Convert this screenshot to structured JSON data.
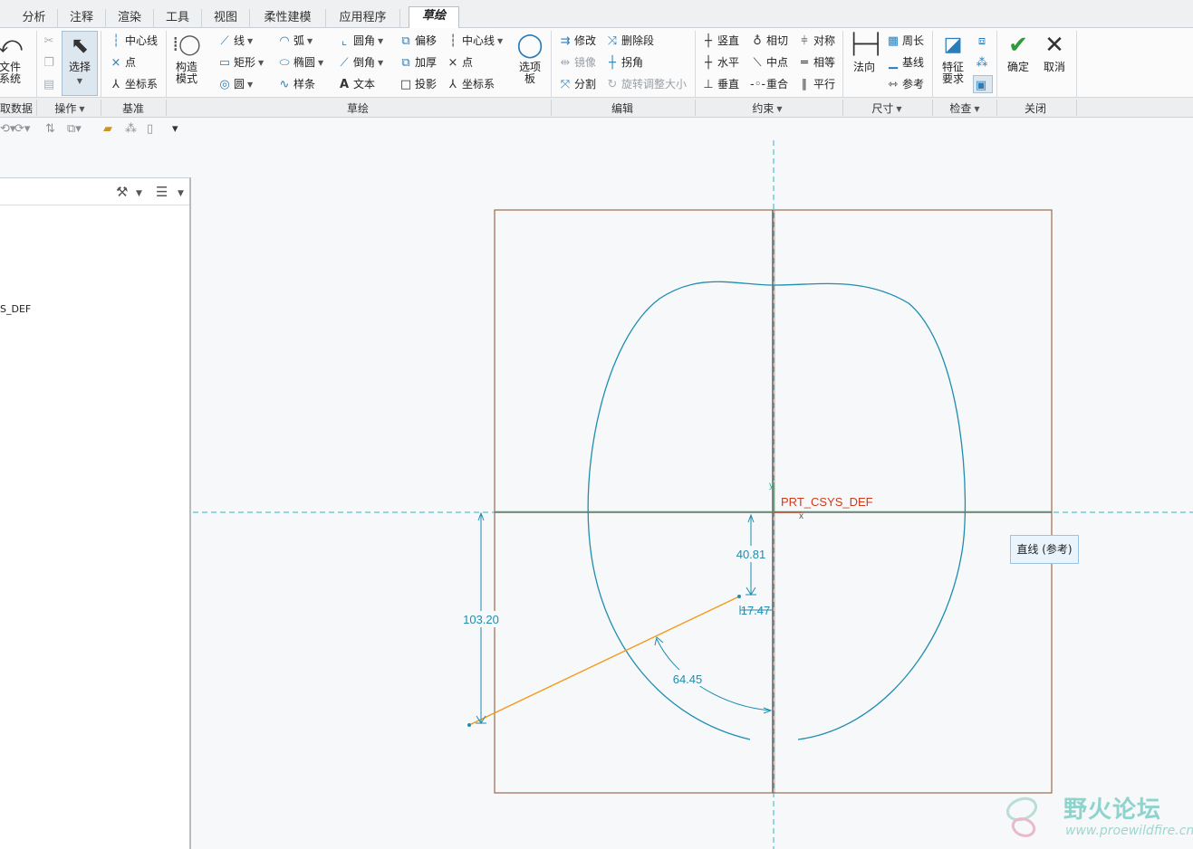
{
  "tabs": [
    "分析",
    "注释",
    "渲染",
    "工具",
    "视图",
    "柔性建模",
    "应用程序",
    "草绘"
  ],
  "ribbon": {
    "get_data": {
      "label1": "文件",
      "label2": "系统"
    },
    "operations": {
      "select_label": "选择"
    },
    "datum": {
      "centerline": "中心线",
      "point": "点",
      "csys": "坐标系"
    },
    "construction": {
      "label1": "构造",
      "label2": "模式"
    },
    "sketch": {
      "line": "线",
      "arc": "弧",
      "fillet": "圆角",
      "offset": "偏移",
      "centerline": "中心线",
      "rectangle": "矩形",
      "ellipse": "椭圆",
      "chamfer": "倒角",
      "thicken": "加厚",
      "point": "点",
      "circle": "圆",
      "spline": "样条",
      "text": "文本",
      "project": "投影",
      "csys": "坐标系",
      "palette1": "选项",
      "palette2": "板"
    },
    "edit": {
      "modify": "修改",
      "delete_segment": "删除段",
      "mirror": "镜像",
      "corner": "拐角",
      "divide": "分割",
      "rotate_resize": "旋转调整大小"
    },
    "constrain": {
      "vertical": "竖直",
      "tangent": "相切",
      "symmetric": "对称",
      "horizontal": "水平",
      "midpoint": "中点",
      "equal": "相等",
      "perpendicular": "垂直",
      "coincident": "重合",
      "parallel": "平行"
    },
    "dimension": {
      "normal": "法向",
      "perimeter": "周长",
      "baseline": "基线",
      "reference": "参考"
    },
    "inspect": {
      "feature_req1": "特征",
      "feature_req2": "要求"
    },
    "close": {
      "ok": "确定",
      "cancel": "取消"
    }
  },
  "groups": [
    "取数据",
    "操作",
    "基准",
    "草绘",
    "编辑",
    "约束",
    "尺寸",
    "检查",
    "关闭"
  ],
  "tree": {
    "item": "S_DEF"
  },
  "canvas": {
    "csys_label": "PRT_CSYS_DEF",
    "axis_y_label": "y",
    "axis_x_label": "x",
    "dims": [
      "103.20",
      "40.81",
      "17.47",
      "64.45"
    ]
  },
  "tooltip": "直线 (参考)",
  "watermark": {
    "title": "野火论坛",
    "url": "www.proewildfire.cn"
  },
  "colors": {
    "sketch": "#1e8db0",
    "active_line": "#f29a18",
    "reference": "#2bb3c9",
    "frame": "#9b6b4a",
    "csys": "#d03a1a"
  }
}
